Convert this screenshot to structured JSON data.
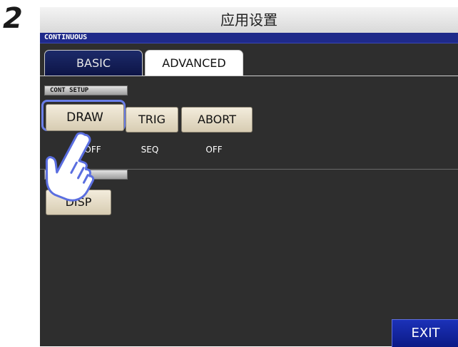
{
  "step": "2",
  "title": "应用设置",
  "screen": {
    "header": "CONTINUOUS",
    "tabs": [
      {
        "label": "BASIC",
        "active": false
      },
      {
        "label": "ADVANCED",
        "active": true
      }
    ],
    "sections": [
      {
        "label": "CONT SETUP",
        "buttons": [
          {
            "label": "DRAW",
            "value": "OFF",
            "highlighted": true
          },
          {
            "label": "TRIG",
            "value": "SEQ"
          },
          {
            "label": "ABORT",
            "value": "OFF"
          }
        ]
      },
      {
        "label": "FUNCTION",
        "buttons": [
          {
            "label": "DISP"
          }
        ]
      }
    ],
    "exit_label": "EXIT"
  },
  "colors": {
    "header_blue": "#1f2a8a",
    "screen_bg": "#2e2e2e",
    "button_beige": "#e8dfc8",
    "highlight_ring": "#6a7ee8",
    "exit_blue": "#1325a8"
  },
  "icons": {
    "pointer": "hand-pointer-icon"
  }
}
